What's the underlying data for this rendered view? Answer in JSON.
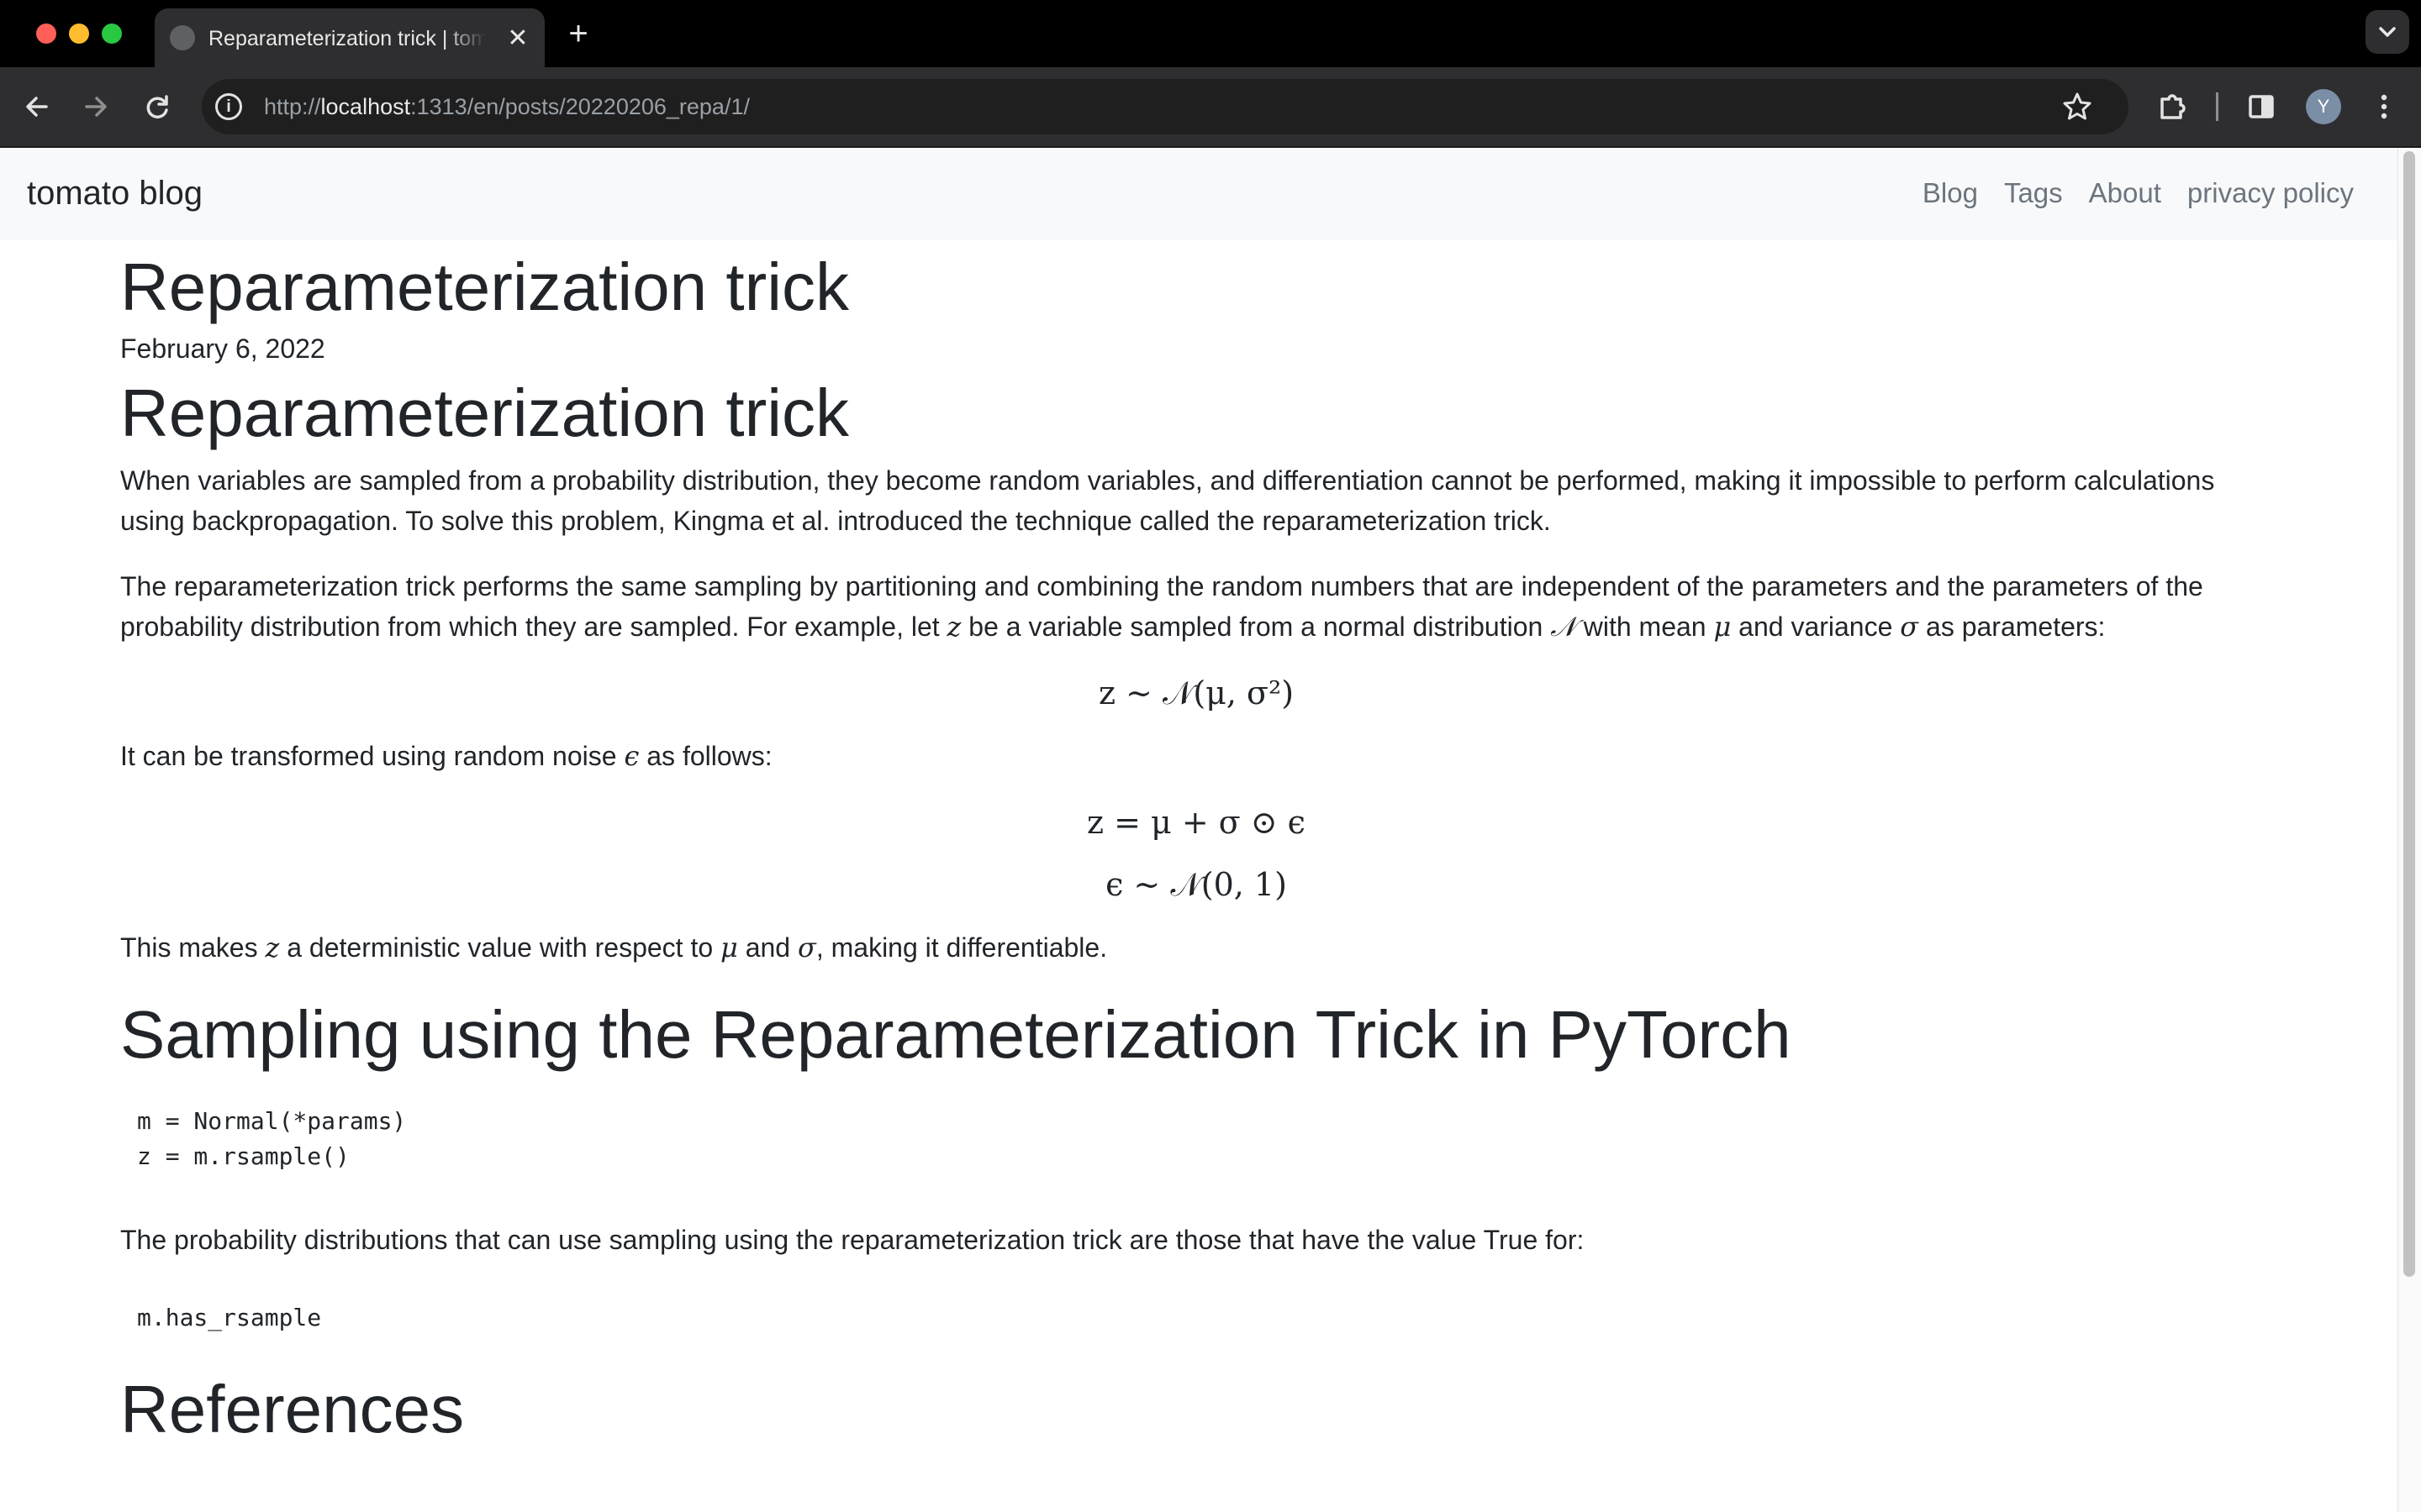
{
  "browser": {
    "tab_title": "Reparameterization trick | tomato blog",
    "tab_close_glyph": "✕",
    "new_tab_glyph": "+",
    "tab_search_glyph": "⌄",
    "url_prefix": "http://",
    "url_host": "localhost",
    "url_path": ":1313/en/posts/20220206_repa/1/",
    "avatar_initial": "Y"
  },
  "site": {
    "brand": "tomato blog",
    "nav": [
      "Blog",
      "Tags",
      "About",
      "privacy policy"
    ]
  },
  "post": {
    "title": "Reparameterization trick",
    "date": "February 6, 2022",
    "heading": "Reparameterization trick",
    "para1": "When variables are sampled from a probability distribution, they become random variables, and differentiation cannot be performed, making it impossible to perform calculations using backpropagation. To solve this problem, Kingma et al. introduced the technique called the reparameterization trick.",
    "para2_a": "The reparameterization trick performs the same sampling by partitioning and combining the random numbers that are independent of the parameters and the parameters of the probability distribution from which they are sampled. For example, let ",
    "para2_z": "z",
    "para2_b": " be a variable sampled from a normal distribution ",
    "para2_N": "𝒩",
    "para2_c": " with mean ",
    "para2_mu": "μ",
    "para2_d": " and variance ",
    "para2_sigma": "σ",
    "para2_e": " as parameters:",
    "eq1": "z ∼ 𝒩(μ, σ²)",
    "para3_a": "It can be transformed using random noise ",
    "para3_eps": "ϵ",
    "para3_b": " as follows:",
    "eq2": "z = μ + σ ⊙ ϵ",
    "eq3": "ϵ ∼ 𝒩(0, 1)",
    "para4_a": "This makes ",
    "para4_z": "z",
    "para4_b": " a deterministic value with respect to ",
    "para4_mu": "μ",
    "para4_c": " and ",
    "para4_sigma": "σ",
    "para4_d": ", making it differentiable.",
    "h2_sampling": "Sampling using the Reparameterization Trick in PyTorch",
    "code1": "m = Normal(*params)\nz = m.rsample()",
    "para5": "The probability distributions that can use sampling using the reparameterization trick are those that have the value True for:",
    "code2": "m.has_rsample",
    "h2_refs": "References"
  }
}
